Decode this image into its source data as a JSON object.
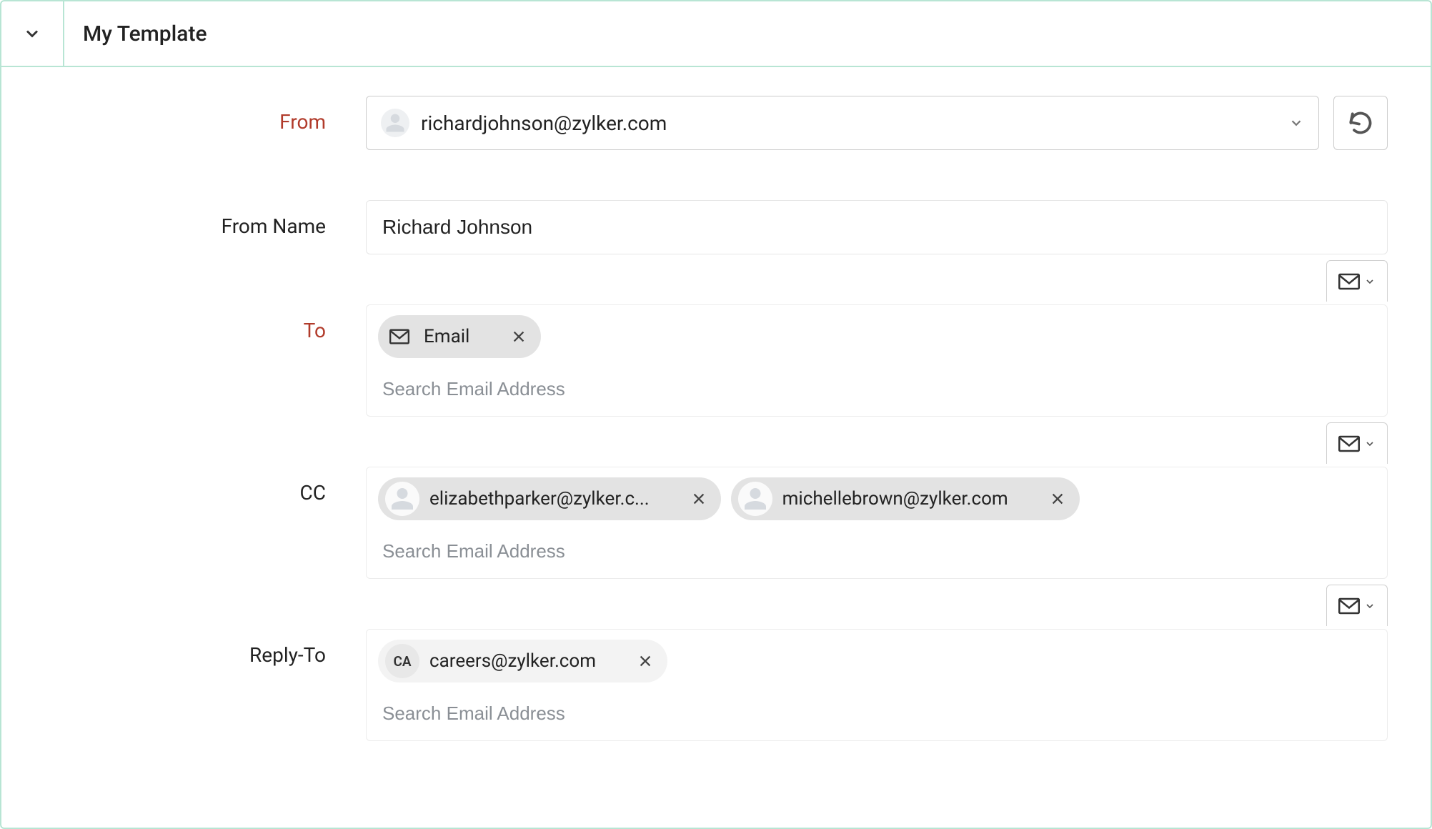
{
  "header": {
    "title": "My Template"
  },
  "form": {
    "from": {
      "label": "From",
      "value": "richardjohnson@zylker.com"
    },
    "fromName": {
      "label": "From Name",
      "value": "Richard Johnson"
    },
    "to": {
      "label": "To",
      "chips": [
        {
          "label": "Email",
          "kind": "email-token"
        }
      ],
      "placeholder": "Search Email Address"
    },
    "cc": {
      "label": "CC",
      "chips": [
        {
          "label": "elizabethparker@zylker.c...",
          "kind": "avatar"
        },
        {
          "label": "michellebrown@zylker.com",
          "kind": "avatar"
        }
      ],
      "placeholder": "Search Email Address"
    },
    "replyTo": {
      "label": "Reply-To",
      "chips": [
        {
          "label": "careers@zylker.com",
          "kind": "initials",
          "initials": "CA"
        }
      ],
      "placeholder": "Search Email Address"
    }
  }
}
